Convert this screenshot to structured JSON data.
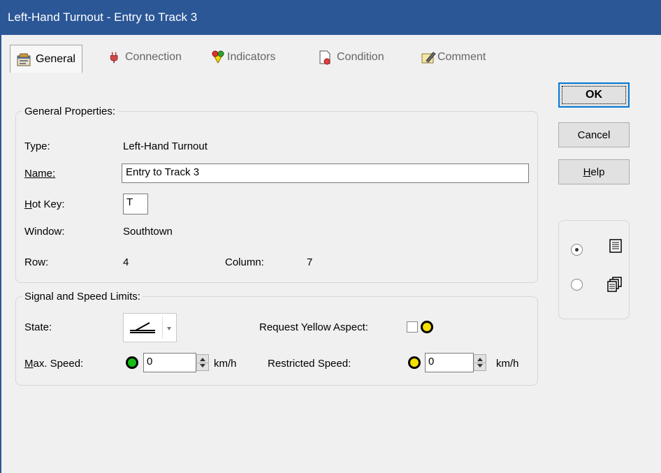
{
  "window": {
    "title": "Left-Hand Turnout - Entry to Track 3"
  },
  "tabs": [
    {
      "label": "General",
      "icon": "general-properties-icon"
    },
    {
      "label": "Connection",
      "icon": "plug-icon"
    },
    {
      "label": "Indicators",
      "icon": "indicators-icon"
    },
    {
      "label": "Condition",
      "icon": "condition-icon"
    },
    {
      "label": "Comment",
      "icon": "comment-icon"
    }
  ],
  "general": {
    "title": "General Properties:",
    "type_label": "Type:",
    "type_value": "Left-Hand Turnout",
    "name_label": "Name:",
    "name_value": "Entry to Track 3",
    "hotkey_label": "Hot Key:",
    "hotkey_value": "T",
    "window_label": "Window:",
    "window_value": "Southtown",
    "row_label": "Row:",
    "row_value": "4",
    "column_label": "Column:",
    "column_value": "7"
  },
  "signal": {
    "title": "Signal and Speed Limits:",
    "state_label": "State:",
    "request_yellow_label": "Request Yellow Aspect:",
    "request_yellow_checked": false,
    "max_speed_label": "Max. Speed:",
    "max_speed_value": "0",
    "max_speed_unit": "km/h",
    "restricted_label": "Restricted Speed:",
    "restricted_value": "0",
    "restricted_unit": "km/h"
  },
  "buttons": {
    "ok": "OK",
    "cancel": "Cancel",
    "help": "Help"
  },
  "colors": {
    "titlebar": "#2b5797",
    "green_aspect": "#14c014",
    "yellow_aspect": "#f5e000"
  }
}
